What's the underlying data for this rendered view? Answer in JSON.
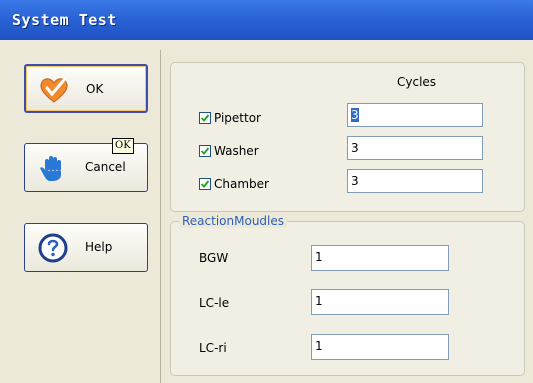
{
  "window": {
    "title": "System Test"
  },
  "buttons": {
    "ok_label": "OK",
    "cancel_label": "Cancel",
    "help_label": "Help",
    "ok_icon": "heart-check-icon",
    "cancel_icon": "hand-stop-icon",
    "help_icon": "help-question-icon"
  },
  "tooltip": {
    "text": "OK"
  },
  "cycles": {
    "header": "Cycles",
    "rows": [
      {
        "label": "Pipettor",
        "checked": true,
        "value": "3"
      },
      {
        "label": "Washer",
        "checked": true,
        "value": "3"
      },
      {
        "label": "Chamber",
        "checked": true,
        "value": "3"
      }
    ]
  },
  "reaction": {
    "legend": "ReactionMoudles",
    "rows": [
      {
        "label": "BGW",
        "value": "1"
      },
      {
        "label": "LC-le",
        "value": "1"
      },
      {
        "label": "LC-ri",
        "value": "1"
      }
    ]
  },
  "colors": {
    "titlebar": "#2a63d6",
    "legend": "#2c5fb8",
    "selection": "#316ac5"
  }
}
